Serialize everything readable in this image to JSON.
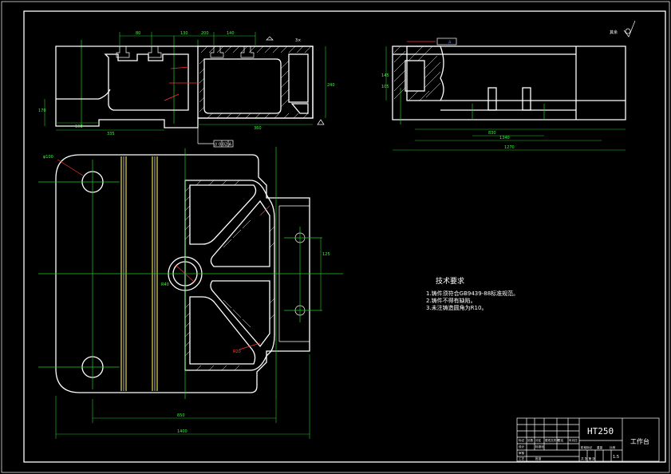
{
  "notes": {
    "title": "技术要求",
    "items": [
      "1.铸件须符合GB9439-88标准规范。",
      "2.铸件不得有缺陷。",
      "3.未注铸造圆角为R10。"
    ]
  },
  "title_block": {
    "material": "HT250",
    "part_name": "工作台",
    "scale": "1:5",
    "small_labels": [
      "标记",
      "处数",
      "分区",
      "更改文件号",
      "签名",
      "年月日",
      "设计",
      "标准化",
      "阶段标记",
      "重量",
      "比例",
      "审核",
      "工艺",
      "批准",
      "共 张 第 张"
    ]
  },
  "symbols": {
    "roughness_label": "其余",
    "datum_a": "A"
  },
  "dimensions": {
    "front_top": [
      "80",
      "130",
      "140",
      "200",
      "3×"
    ],
    "front_bottom": [
      "100",
      "335",
      "360"
    ],
    "front_right": [
      "240",
      "170"
    ],
    "side_bottom": [
      "830",
      "1340",
      "1270"
    ],
    "side_left": [
      "145",
      "105"
    ],
    "plan_bottom": [
      "650",
      "1400"
    ],
    "plan_right": [
      "125"
    ],
    "plan_labels": [
      "φ100",
      "R40",
      "R20"
    ]
  },
  "tolerance": "// 0.02 A"
}
